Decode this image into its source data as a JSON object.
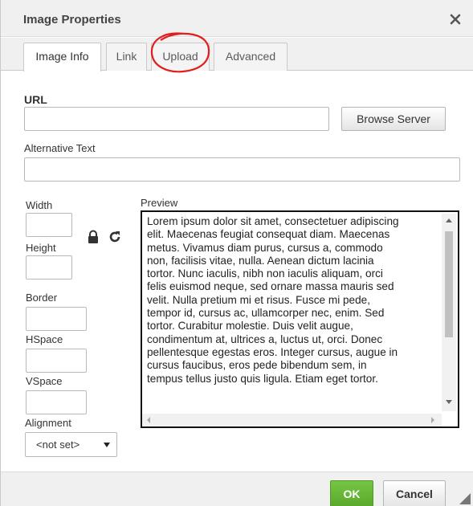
{
  "dialog": {
    "title": "Image Properties"
  },
  "tabs": [
    {
      "label": "Image Info",
      "active": true
    },
    {
      "label": "Link",
      "active": false
    },
    {
      "label": "Upload",
      "active": false
    },
    {
      "label": "Advanced",
      "active": false
    }
  ],
  "fields": {
    "url_label": "URL",
    "url_value": "",
    "browse_label": "Browse Server",
    "alt_label": "Alternative Text",
    "alt_value": "",
    "width_label": "Width",
    "height_label": "Height",
    "border_label": "Border",
    "hspace_label": "HSpace",
    "vspace_label": "VSpace",
    "alignment_label": "Alignment",
    "alignment_value": "<not set>"
  },
  "preview": {
    "label": "Preview",
    "text": "Lorem ipsum dolor sit amet, consectetuer adipiscing\nelit. Maecenas feugiat consequat diam. Maecenas\nmetus. Vivamus diam purus, cursus a, commodo\nnon, facilisis vitae, nulla. Aenean dictum lacinia\ntortor. Nunc iaculis, nibh non iaculis aliquam, orci\nfelis euismod neque, sed ornare massa mauris sed\nvelit. Nulla pretium mi et risus. Fusce mi pede,\ntempor id, cursus ac, ullamcorper nec, enim. Sed\ntortor. Curabitur molestie. Duis velit augue,\ncondimentum at, ultrices a, luctus ut, orci. Donec\npellentesque egestas eros. Integer cursus, augue in\ncursus faucibus, eros pede bibendum sem, in\ntempus tellus justo quis ligula. Etiam eget tortor."
  },
  "footer": {
    "ok_label": "OK",
    "cancel_label": "Cancel"
  },
  "colors": {
    "ok_green": "#5aa82c",
    "annotation_red": "#e01e1e"
  }
}
